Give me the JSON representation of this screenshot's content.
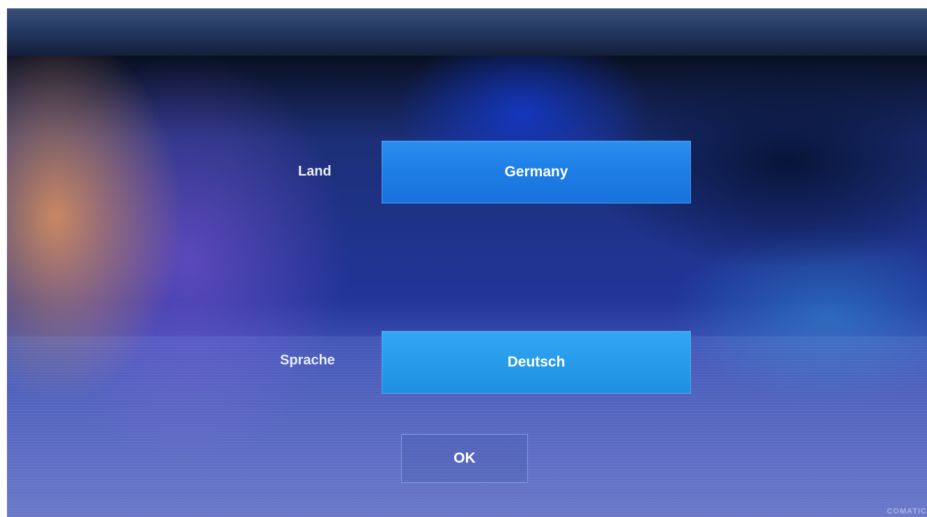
{
  "form": {
    "country_label": "Land",
    "country_value": "Germany",
    "language_label": "Sprache",
    "language_value": "Deutsch",
    "ok_label": "OK"
  },
  "watermark": "COMATIC",
  "colors": {
    "field_background": "#1e7ee6",
    "field_background_lower": "#279be9",
    "text": "#ffffff"
  }
}
